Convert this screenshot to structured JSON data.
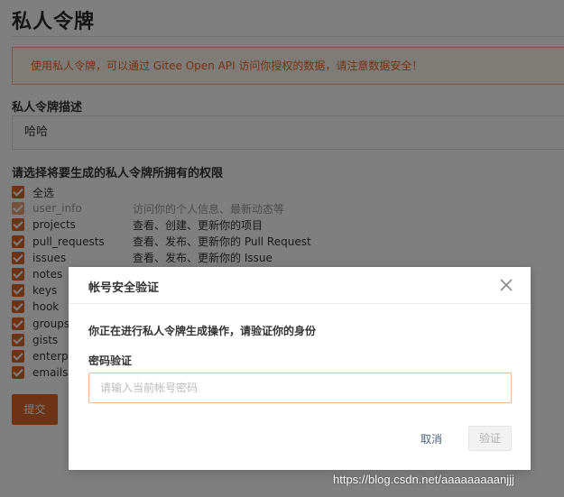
{
  "page": {
    "title": "私人令牌",
    "alert": "使用私人令牌，可以通过 Gitee Open API 访问你授权的数据，请注意数据安全！",
    "desc_label": "私人令牌描述",
    "desc_value": "哈哈",
    "scopes_label": "请选择将要生成的私人令牌所拥有的权限",
    "scopes": [
      {
        "name": "全选",
        "desc": "",
        "checked": true,
        "disabled": false
      },
      {
        "name": "user_info",
        "desc": "访问你的个人信息、最新动态等",
        "checked": true,
        "disabled": true
      },
      {
        "name": "projects",
        "desc": "查看、创建、更新你的项目",
        "checked": true,
        "disabled": false
      },
      {
        "name": "pull_requests",
        "desc": "查看、发布、更新你的 Pull Request",
        "checked": true,
        "disabled": false
      },
      {
        "name": "issues",
        "desc": "查看、发布、更新你的 Issue",
        "checked": true,
        "disabled": false
      },
      {
        "name": "notes",
        "desc": "",
        "checked": true,
        "disabled": false
      },
      {
        "name": "keys",
        "desc": "",
        "checked": true,
        "disabled": false
      },
      {
        "name": "hook",
        "desc": "",
        "checked": true,
        "disabled": false
      },
      {
        "name": "groups",
        "desc": "",
        "checked": true,
        "disabled": false
      },
      {
        "name": "gists",
        "desc": "",
        "checked": true,
        "disabled": false
      },
      {
        "name": "enterpr",
        "desc": "",
        "checked": true,
        "disabled": false
      },
      {
        "name": "emails",
        "desc": "",
        "checked": true,
        "disabled": false
      }
    ],
    "submit_label": "提交"
  },
  "modal": {
    "title": "帐号安全验证",
    "message": "你正在进行私人令牌生成操作，请验证你的身份",
    "password_label": "密码验证",
    "password_placeholder": "请输入当前帐号密码",
    "password_value": "",
    "cancel_label": "取消",
    "verify_label": "验证"
  },
  "watermark": "https://blog.csdn.net/aaaaaaaaanjjj",
  "colors": {
    "accent": "#d9682a",
    "alert_bg": "#fff6ee",
    "alert_border": "#f1b48c",
    "alert_text": "#e0692d",
    "overlay": "rgba(0,0,0,0.5)",
    "link": "#4a6178"
  },
  "icons": {
    "close": "close-icon",
    "checkbox": "checkbox-checked-icon"
  }
}
